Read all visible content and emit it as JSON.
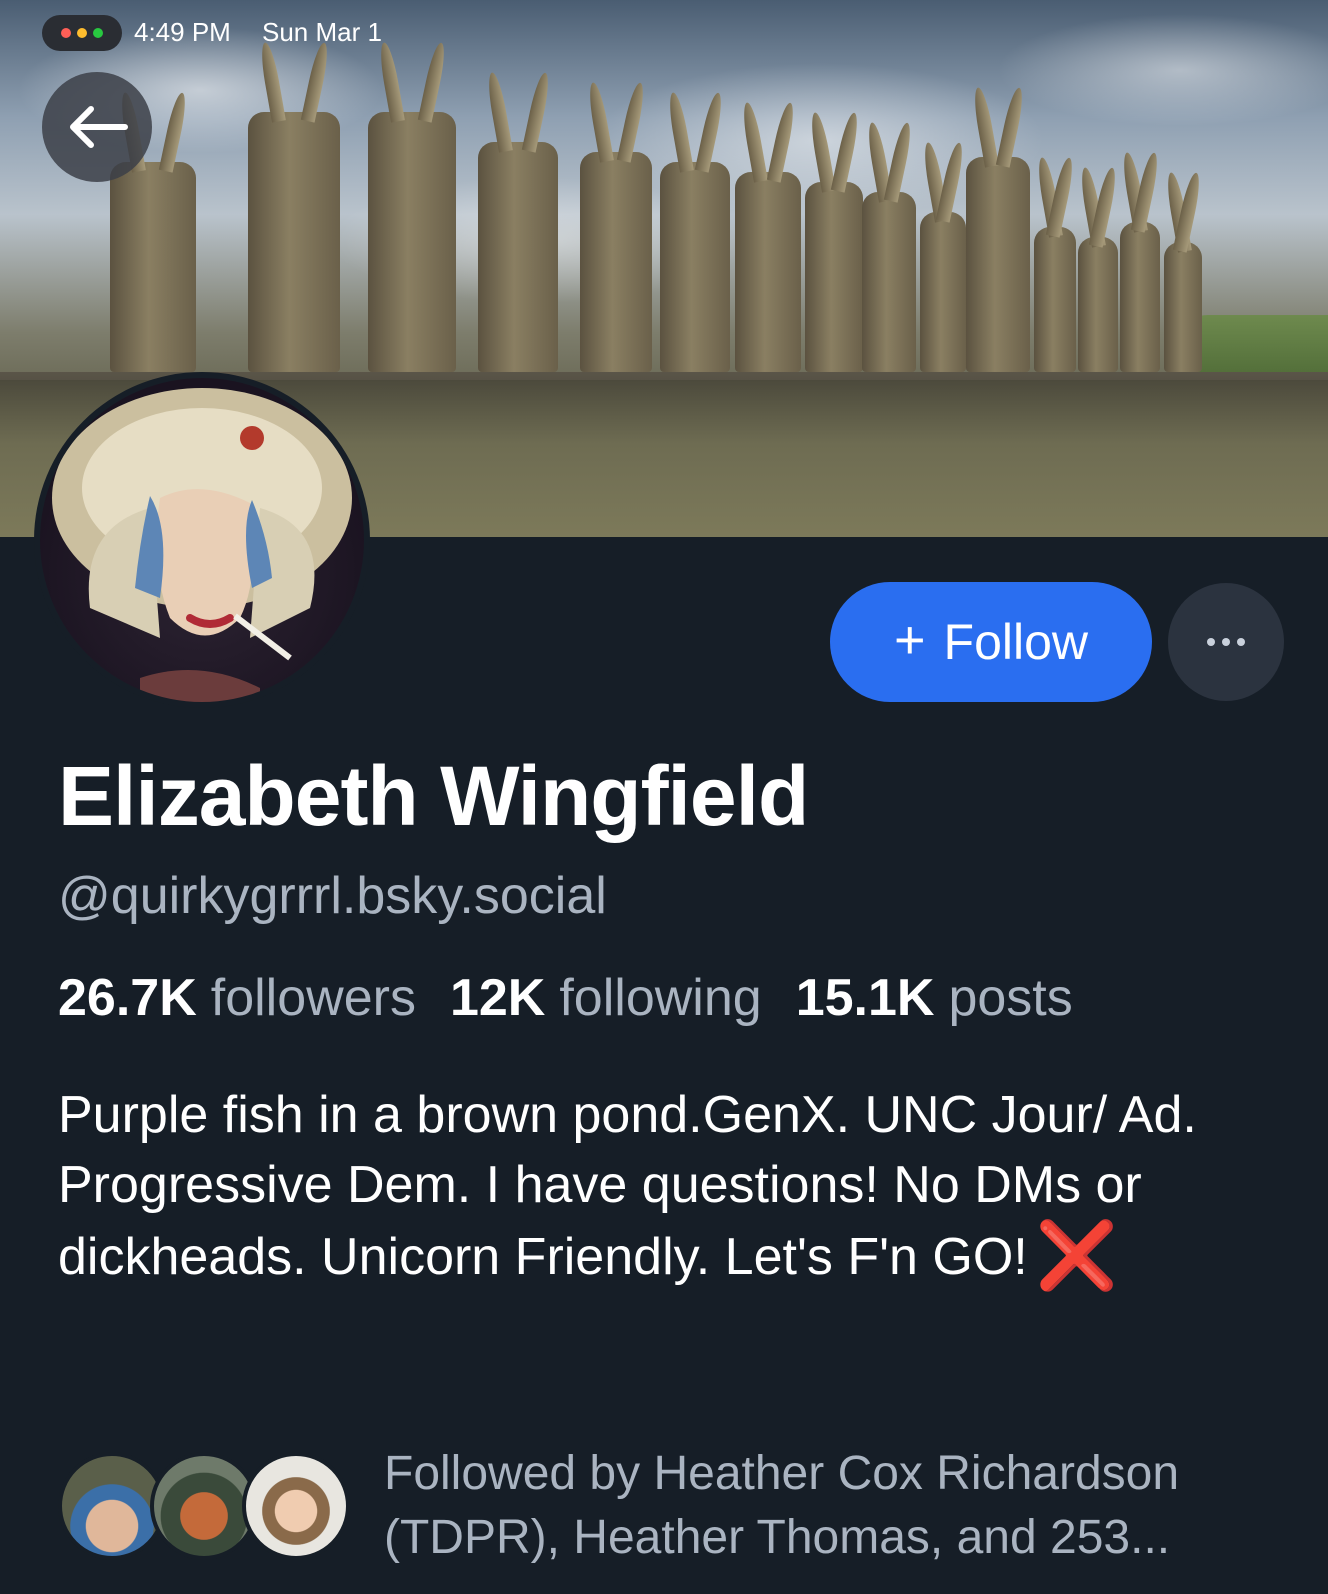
{
  "status_bar": {
    "time": "4:49 PM",
    "date": "Sun Mar 1"
  },
  "profile": {
    "display_name": "Elizabeth Wingfield",
    "handle": "@quirkygrrrl.bsky.social",
    "stats": {
      "followers_count": "26.7K",
      "followers_label": "followers",
      "following_count": "12K",
      "following_label": "following",
      "posts_count": "15.1K",
      "posts_label": "posts"
    },
    "bio": "Purple fish in a brown pond.GenX. UNC Jour/ Ad. Progressive Dem. I have questions! No DMs or dickheads. Unicorn Friendly. Let's F'n GO!",
    "bio_emoji": "❌"
  },
  "actions": {
    "follow_label": "Follow",
    "follow_icon": "plus-icon",
    "more_icon": "ellipsis-icon",
    "back_icon": "arrow-left-icon"
  },
  "followed_by": {
    "text": "Followed by Heather Cox Richardson (TDPR), Heather Thomas, and 253..."
  },
  "colors": {
    "background": "#161e27",
    "accent": "#2a6ef0",
    "secondary_text": "#aab4c1",
    "more_button": "#2b333f"
  }
}
